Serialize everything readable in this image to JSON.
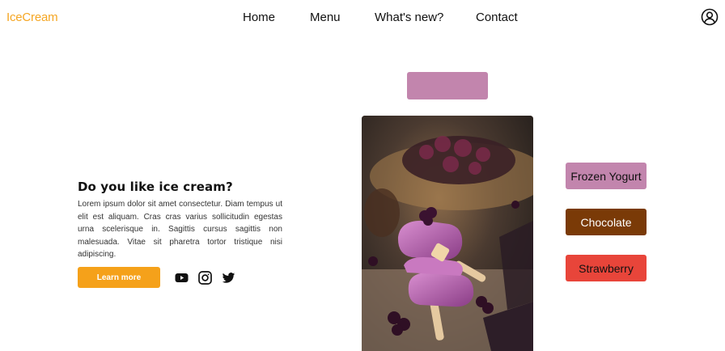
{
  "header": {
    "logo": "IceCream",
    "nav": [
      "Home",
      "Menu",
      "What's new?",
      "Contact"
    ],
    "user_icon": "user-circle-icon"
  },
  "hero": {
    "title": "Do you like ice cream?",
    "body": "Lorem ipsum dolor sit amet consectetur. Diam tempus ut elit est aliquam. Cras cras varius sollicitudin egestas urna scelerisque in. Sagittis cursus sagittis non malesuada. Vitae sit pharetra tortor tristique nisi adipiscing.",
    "button": "Learn more",
    "social_icons": [
      "youtube-icon",
      "instagram-icon",
      "twitter-icon"
    ]
  },
  "flavors": [
    {
      "label": "Frozen Yogurt",
      "color": "#c285ad"
    },
    {
      "label": "Chocolate",
      "color": "#7a3a07"
    },
    {
      "label": "Strawberry",
      "color": "#e8453a"
    }
  ],
  "colors": {
    "accent": "#f5a11a",
    "selected_swatch": "#c285ad"
  }
}
